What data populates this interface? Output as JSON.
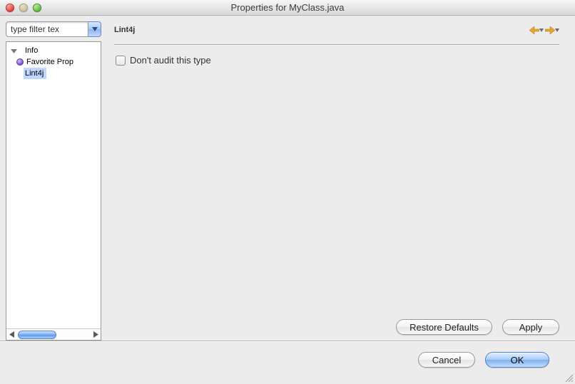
{
  "window": {
    "title": "Properties for MyClass.java"
  },
  "filter": {
    "value": "type filter tex"
  },
  "tree": {
    "items": [
      {
        "label": "Info",
        "indent": 0,
        "expanded": true,
        "selected": false,
        "hasChildren": true,
        "icon": "none"
      },
      {
        "label": "Favorite Prop",
        "indent": 1,
        "expanded": false,
        "selected": false,
        "hasChildren": false,
        "icon": "purple-ball"
      },
      {
        "label": "Lint4j",
        "indent": 0,
        "expanded": false,
        "selected": true,
        "hasChildren": false,
        "icon": "none"
      }
    ]
  },
  "panel": {
    "title": "Lint4j",
    "checkbox": {
      "checked": false,
      "label": "Don't audit this type"
    },
    "buttons": {
      "restore_defaults": "Restore Defaults",
      "apply": "Apply"
    }
  },
  "footer": {
    "cancel": "Cancel",
    "ok": "OK"
  }
}
